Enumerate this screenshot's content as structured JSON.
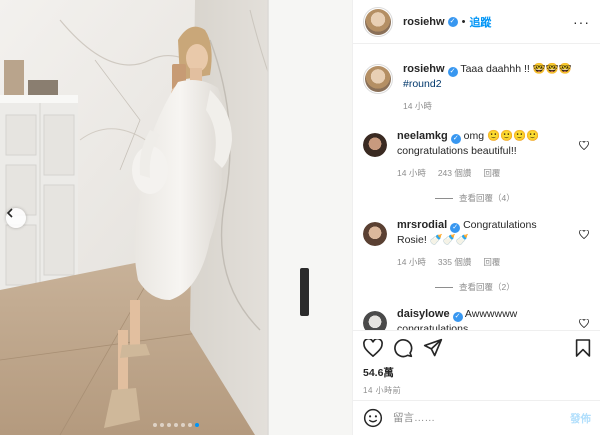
{
  "header": {
    "username": "rosiehw",
    "separator": "•",
    "follow_label": "追蹤",
    "more_label": "···"
  },
  "caption": {
    "username": "rosiehw",
    "text": "Taaa daahhh !! 🤓🤓🤓",
    "hashtag": "#round2",
    "time": "14 小時"
  },
  "comments": [
    {
      "username": "neelamkg",
      "text": "omg 🙂🙂🙂🙂",
      "text2": "congratulations beautiful!!",
      "time": "14 小時",
      "likes": "243 個讚",
      "reply": "回覆",
      "view_replies": "查看回覆（4）"
    },
    {
      "username": "mrsrodial",
      "text": "Congratulations",
      "text2": "Rosie! 🍼🍼🍼",
      "time": "14 小時",
      "likes": "335 個讚",
      "reply": "回覆",
      "view_replies": "查看回覆（2）"
    },
    {
      "username": "daisylowe",
      "text": "Awwwwww",
      "text2": "congratulations"
    }
  ],
  "stats": {
    "likes": "54.6萬",
    "time": "14 小時前"
  },
  "composer": {
    "placeholder": "留言……",
    "post_label": "發佈"
  },
  "carousel": {
    "slides": 7,
    "active": 6
  },
  "colors": {
    "accent": "#0095f6",
    "verified": "#3897f0",
    "post_disabled": "#b2dffc",
    "muted": "#8e8e8e"
  },
  "icons": [
    "verified-badge-icon",
    "more-options-icon",
    "heart-icon",
    "comment-icon",
    "share-icon",
    "bookmark-icon",
    "emoji-icon",
    "chevron-left-icon"
  ]
}
